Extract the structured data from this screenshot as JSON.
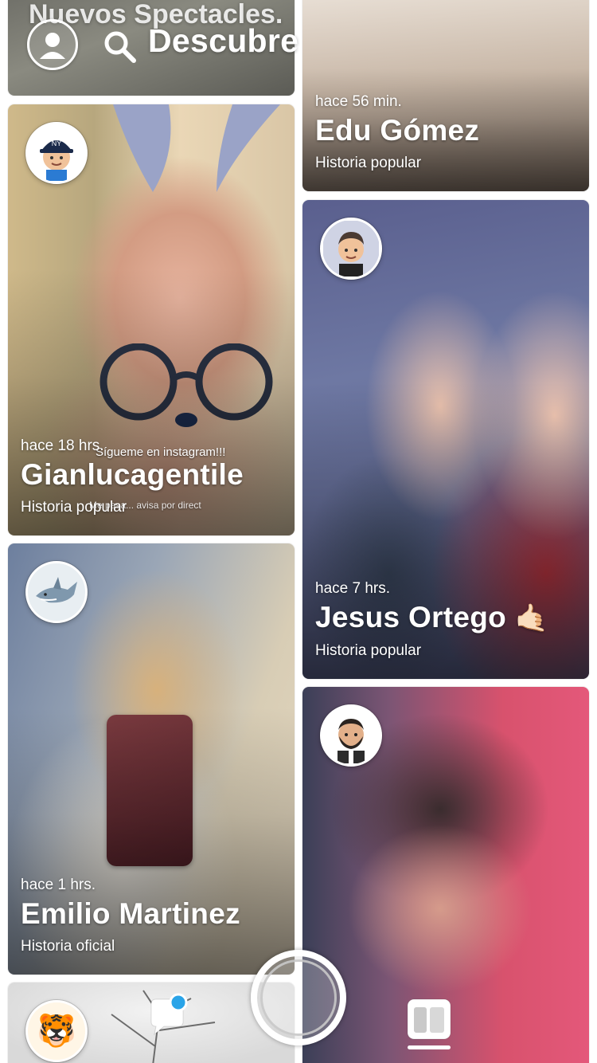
{
  "header": {
    "title": "Descubre",
    "profile_icon": "profile-silhouette-icon",
    "search_icon": "search-icon"
  },
  "spectacles_card": {
    "title": "Nuevos Spectacles."
  },
  "cards": [
    {
      "id": "gianlucagentile",
      "time": "hace 18 hrs.",
      "name": "Gianlucagentile",
      "type": "Historia popular",
      "overlay_text": "Sígueme en instagram!!!",
      "overlay_text2": "Me pasa... avisa por direct"
    },
    {
      "id": "emilio-martinez",
      "time": "hace 1 hrs.",
      "name": "Emilio Martinez",
      "type": "Historia oficial"
    },
    {
      "id": "edu-gomez",
      "time": "hace 56 min.",
      "name": "Edu Gómez",
      "type": "Historia popular"
    },
    {
      "id": "jesus-ortego",
      "time": "hace 7 hrs.",
      "name": "Jesus Ortego",
      "type": "Historia popular",
      "emoji": "🤙🏻"
    }
  ],
  "colors": {
    "notification_dot": "#2aa4e8",
    "white": "#ffffff"
  },
  "bottom_bar": {
    "chat_icon": "chat-icon",
    "capture_icon": "capture-button",
    "discover_icon": "discover-icon"
  }
}
